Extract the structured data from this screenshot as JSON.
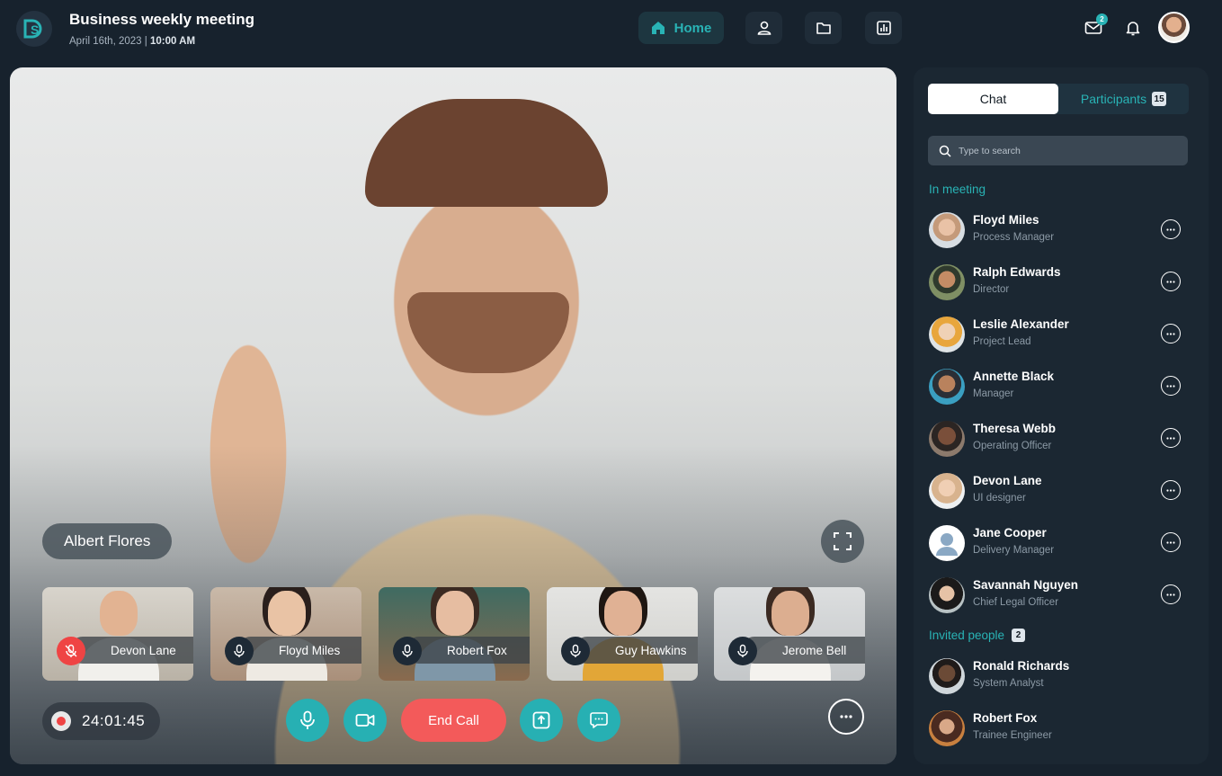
{
  "header": {
    "title": "Business weekly meeting",
    "date": "April 16th, 2023",
    "separator": "|",
    "time": "10:00 AM",
    "logo_text": "S",
    "nav": {
      "home_label": "Home"
    },
    "mail_badge": "2"
  },
  "stage": {
    "speaker_name": "Albert Flores",
    "timer": "24:01:45",
    "end_call_label": "End Call",
    "thumbnails": [
      {
        "name": "Devon Lane",
        "muted": true
      },
      {
        "name": "Floyd Miles",
        "muted": false
      },
      {
        "name": "Robert Fox",
        "muted": false
      },
      {
        "name": "Guy Hawkins",
        "muted": false
      },
      {
        "name": "Jerome Bell",
        "muted": false
      }
    ]
  },
  "panel": {
    "tabs": {
      "chat": "Chat",
      "participants": "Participants",
      "participants_count": "15"
    },
    "search_placeholder": "Type to search",
    "in_meeting_label": "In meeting",
    "in_meeting": [
      {
        "name": "Floyd Miles",
        "role": "Process Manager"
      },
      {
        "name": "Ralph Edwards",
        "role": "Director"
      },
      {
        "name": "Leslie Alexander",
        "role": "Project Lead"
      },
      {
        "name": "Annette Black",
        "role": "Manager"
      },
      {
        "name": "Theresa Webb",
        "role": "Operating Officer"
      },
      {
        "name": "Devon Lane",
        "role": "UI designer"
      },
      {
        "name": "Jane Cooper",
        "role": "Delivery Manager"
      },
      {
        "name": "Savannah Nguyen",
        "role": "Chief Legal Officer"
      }
    ],
    "invited_label": "Invited people",
    "invited_count": "2",
    "invited": [
      {
        "name": "Ronald Richards",
        "role": "System Analyst"
      },
      {
        "name": "Robert Fox",
        "role": "Trainee Engineer"
      }
    ]
  },
  "colors": {
    "accent": "#29b3b5",
    "background": "#17222d",
    "end_call": "#f35a5a",
    "muted_mic": "#ef4444"
  },
  "icons": [
    "home-icon",
    "people-icon",
    "folder-icon",
    "chart-icon",
    "mail-icon",
    "bell-icon",
    "search-icon",
    "mic-icon",
    "mic-off-icon",
    "video-icon",
    "share-screen-icon",
    "chat-icon",
    "more-icon",
    "fullscreen-icon"
  ]
}
